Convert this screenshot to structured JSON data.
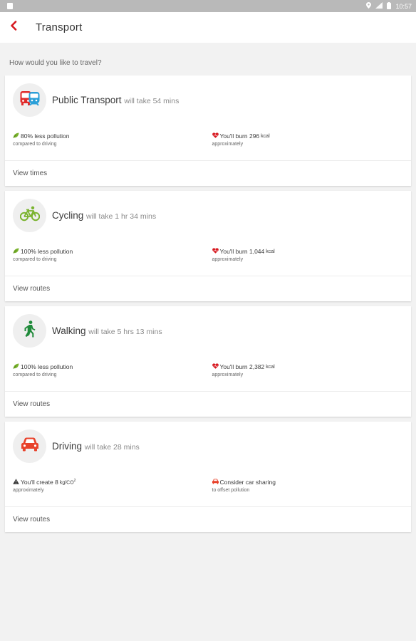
{
  "status_bar": {
    "time": "10:57",
    "color": "#b9b9b9"
  },
  "header": {
    "title": "Transport",
    "accent_color": "#d71920"
  },
  "prompt": "How would you like to travel?",
  "modes": [
    {
      "icon": "bus-train-icon",
      "name": "Public Transport",
      "duration": "will take 54 mins",
      "pollution_text": "80% less pollution",
      "pollution_sub": "compared to driving",
      "calorie_text": "You'll burn 296",
      "calorie_unit": "kcal",
      "calorie_sub": "approximately",
      "action": "View times"
    },
    {
      "icon": "bicycle-icon",
      "name": "Cycling",
      "duration": "will take 1 hr 34 mins",
      "pollution_text": "100% less pollution",
      "pollution_sub": "compared to driving",
      "calorie_text": "You'll burn 1,044",
      "calorie_unit": "kcal",
      "calorie_sub": "approximately",
      "action": "View routes"
    },
    {
      "icon": "walking-person-icon",
      "name": "Walking",
      "duration": "will take 5 hrs 13 mins",
      "pollution_text": "100% less pollution",
      "pollution_sub": "compared to driving",
      "calorie_text": "You'll burn 2,382",
      "calorie_unit": "kcal",
      "calorie_sub": "approximately",
      "action": "View routes"
    },
    {
      "icon": "car-icon",
      "name": "Driving",
      "duration": "will take 28 mins",
      "emission_text": "You'll create 8",
      "emission_unit": "kg/CO",
      "emission_sup": "2",
      "emission_sub": "approximately",
      "share_text": "Consider car sharing",
      "share_sub": "to offset pollution",
      "action": "View routes"
    }
  ],
  "colors": {
    "public_transport_bus": "#e02b2b",
    "public_transport_train": "#2a9fd8",
    "cycling": "#7ab32e",
    "walking": "#1f8a3a",
    "driving": "#e8422b",
    "leaf": "#7ab32e",
    "heart": "#d71920",
    "warning": "#333333"
  }
}
